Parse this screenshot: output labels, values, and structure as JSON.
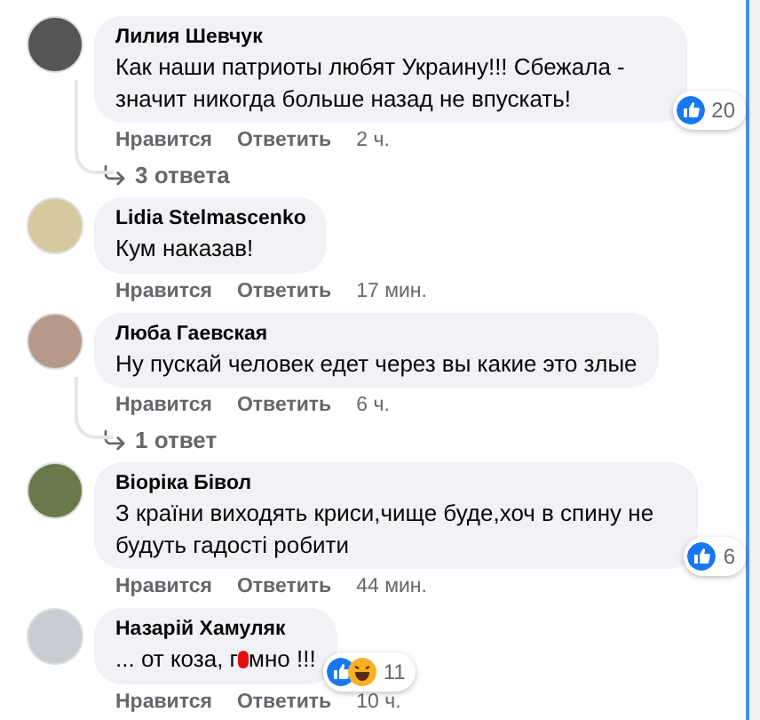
{
  "comments": [
    {
      "author": "Лилия Шевчук",
      "text": [
        "Как наши патриоты любят Украину!!! Сбежала - значит никогда больше назад не впускать!"
      ],
      "reactions": {
        "kinds": [
          {
            "kind": "like"
          }
        ],
        "count": "20"
      },
      "actions": [
        "Нравится",
        "Ответить"
      ],
      "time": "2 ч.",
      "replies": "3 ответа"
    },
    {
      "author": "Lidia Stelmascenko",
      "text": [
        "Кум наказав!"
      ],
      "actions": [
        "Нравится",
        "Ответить"
      ],
      "time": "17 мин."
    },
    {
      "author": "Люба Гаевская",
      "text": [
        "Ну пускай человек едет через вы какие это злые"
      ],
      "actions": [
        "Нравится",
        "Ответить"
      ],
      "time": "6 ч.",
      "replies": "1 ответ"
    },
    {
      "author": "Віоріка Бівол",
      "text": [
        "З країни виходять криси,чище буде,хоч в спину не будуть гадості робити"
      ],
      "reactions": {
        "kinds": [
          {
            "kind": "like"
          }
        ],
        "count": "6"
      },
      "actions": [
        "Нравится",
        "Ответить"
      ],
      "time": "44 мин."
    },
    {
      "author": "Назарій Хамуляк",
      "text": [
        "... от коза, г",
        "мно !!!"
      ],
      "reactions": {
        "kinds": [
          {
            "kind": "like"
          },
          {
            "kind": "haha"
          }
        ],
        "count": "11"
      },
      "actions": [
        "Нравится",
        "Ответить"
      ],
      "time": "10 ч."
    }
  ]
}
